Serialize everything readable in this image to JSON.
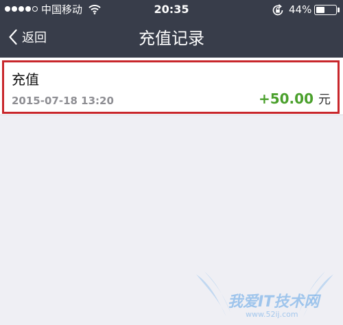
{
  "status_bar": {
    "carrier": "中国移动",
    "time": "20:35",
    "battery_percent": "44%",
    "signal_strength": 4,
    "battery_level": 0.44,
    "icons": [
      "signal-icon",
      "wifi-icon",
      "lock-rotation-icon",
      "battery-icon"
    ]
  },
  "nav": {
    "back_label": "返回",
    "title": "充值记录",
    "icons": [
      "chevron-left-icon"
    ]
  },
  "record": {
    "title": "充值",
    "datetime": "2015-07-18 13:20",
    "amount": "+50.00",
    "unit": "元"
  },
  "watermark": {
    "text": "我爱IT技术网",
    "url": "www.52ij.com"
  },
  "colors": {
    "nav_background": "#383d4a",
    "page_background": "#efeff4",
    "amount_green": "#4aa02c",
    "highlight_red": "#c8262b",
    "date_gray": "#8e8e93"
  }
}
